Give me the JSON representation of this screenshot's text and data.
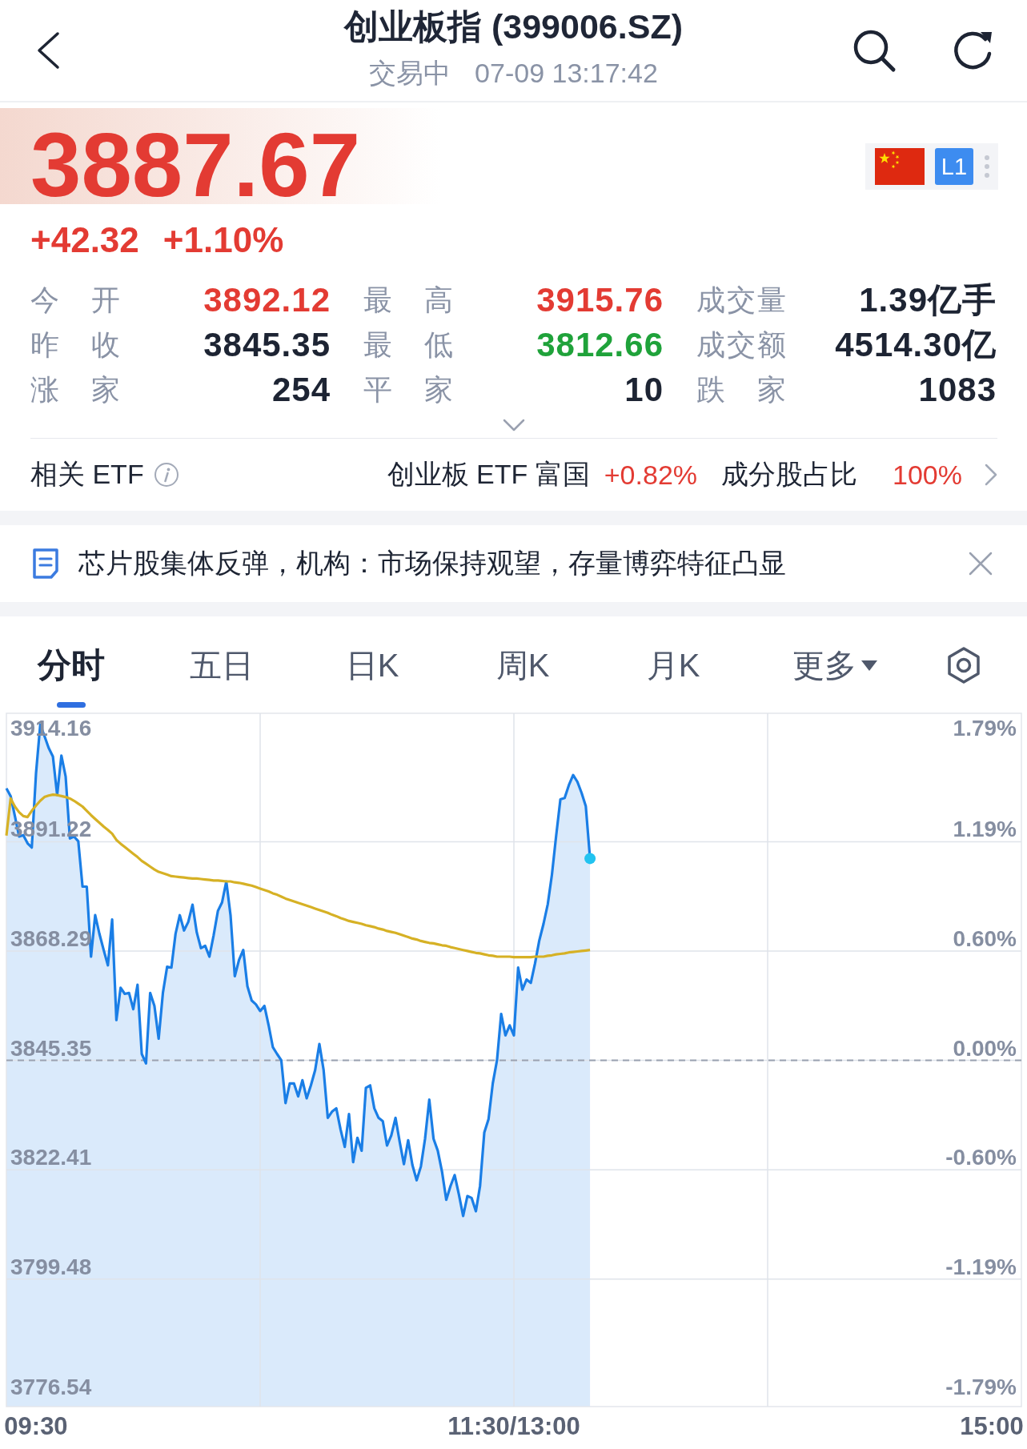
{
  "header": {
    "title": "创业板指 (399006.SZ)",
    "status": "交易中",
    "time": "07-09 13:17:42"
  },
  "quote": {
    "price": "3887.67",
    "change": "+42.32",
    "change_percent": "+1.10%",
    "rising": true,
    "level_badge": "L1"
  },
  "stats": {
    "expanded": false,
    "rows": [
      [
        {
          "label": "今 开",
          "value": "3892.12",
          "color": "#e33b33"
        },
        {
          "label": "最 高",
          "value": "3915.76",
          "color": "#e33b33"
        },
        {
          "label": "成交量",
          "value": "1.39亿手",
          "color": "#1d2433"
        }
      ],
      [
        {
          "label": "昨 收",
          "value": "3845.35",
          "color": "#1d2433"
        },
        {
          "label": "最 低",
          "value": "3812.66",
          "color": "#1fa23a"
        },
        {
          "label": "成交额",
          "value": "4514.30亿",
          "color": "#1d2433"
        }
      ],
      [
        {
          "label": "涨 家",
          "value": "254",
          "color": "#1d2433"
        },
        {
          "label": "平 家",
          "value": "10",
          "color": "#1d2433"
        },
        {
          "label": "跌 家",
          "value": "1083",
          "color": "#1d2433"
        }
      ]
    ]
  },
  "etf": {
    "label": "相关 ETF",
    "fund": "创业板 ETF 富国",
    "change": "+0.82%",
    "rising": true,
    "ratio_label": "成分股占比",
    "ratio": "100%"
  },
  "news": {
    "headline": "芯片股集体反弹，机构：市场保持观望，存量博弈特征凸显"
  },
  "chart_tabs": [
    {
      "label": "分时",
      "selected": true,
      "kind": "tab"
    },
    {
      "label": "五日",
      "selected": false,
      "kind": "tab"
    },
    {
      "label": "日K",
      "selected": false,
      "kind": "tab"
    },
    {
      "label": "周K",
      "selected": false,
      "kind": "tab"
    },
    {
      "label": "月K",
      "selected": false,
      "kind": "tab"
    },
    {
      "label": "更多",
      "selected": false,
      "kind": "menu"
    }
  ],
  "chart": {
    "percent_labels": [
      "1.79%",
      "1.19%",
      "0.60%",
      "0.00%",
      "-0.60%",
      "-1.19%",
      "-1.79%"
    ],
    "chart_data": {
      "type": "line",
      "grid": true,
      "categories": [
        null,
        null,
        null,
        null,
        null,
        null,
        null,
        "09:30",
        null,
        null,
        null,
        null,
        null,
        null,
        null,
        null,
        null,
        null,
        null,
        null,
        null,
        null,
        null,
        null,
        null,
        null,
        null,
        null,
        null,
        null,
        null,
        null,
        null,
        null,
        null,
        null,
        null,
        null,
        null,
        null,
        null,
        null,
        null,
        null,
        null,
        null,
        null,
        null,
        null,
        null,
        null,
        null,
        null,
        null,
        null,
        null,
        null,
        null,
        null,
        null,
        null,
        null,
        null,
        null,
        null,
        null,
        null,
        null,
        null,
        null,
        null,
        null,
        null,
        null,
        null,
        null,
        null,
        null,
        null,
        null,
        null,
        null,
        null,
        null,
        null,
        null,
        null,
        null,
        null,
        null,
        null,
        null,
        null,
        null,
        null,
        null,
        null,
        null,
        null,
        null,
        null,
        null,
        null,
        null,
        null,
        null,
        null,
        null,
        null,
        null,
        null,
        null,
        null,
        null,
        null,
        null,
        null,
        null,
        null,
        null,
        "11:30/13:00",
        null,
        null,
        null,
        null,
        null,
        null,
        null,
        null,
        null,
        null,
        null,
        null,
        null,
        null,
        null,
        null,
        null,
        null,
        null,
        null,
        null,
        null,
        null,
        null,
        null,
        null,
        null,
        null,
        null,
        null,
        null,
        null,
        null,
        null,
        null,
        null,
        null,
        null,
        null,
        null,
        null,
        null,
        null,
        null,
        null,
        null,
        null,
        null,
        null,
        null,
        null,
        null,
        null,
        null,
        null,
        null,
        null,
        null,
        null,
        null,
        null,
        null,
        null,
        null,
        null,
        null,
        null,
        null,
        null,
        null,
        null,
        null,
        null,
        null,
        null,
        null,
        null,
        null,
        null,
        null,
        null,
        null,
        null,
        null,
        null,
        null,
        null,
        null,
        null,
        null,
        null,
        null,
        null,
        null,
        null,
        null,
        null,
        null,
        null,
        null,
        null,
        null,
        null,
        null,
        null,
        null,
        null,
        null,
        null,
        null,
        null,
        null,
        "15:00",
        null,
        null,
        null,
        null,
        null,
        null,
        null
      ],
      "series": [
        {
          "color": "#1a7ee6",
          "values": [
            3902.4,
            3900.8,
            3896.6,
            3892.3,
            3892.6,
            3890.9,
            3890.0,
            3905.6,
            3915.8,
            3913.4,
            3910.9,
            3909.1,
            3901.0,
            3909.3,
            3904.9,
            3891.9,
            3892.3,
            3891.3,
            3881.8,
            3881.8,
            3867.1,
            3875.8,
            3871.9,
            3868.5,
            3865.3,
            3874.9,
            3853.8,
            3860.6,
            3859.3,
            3859.5,
            3856.1,
            3861.2,
            3846.7,
            3844.7,
            3859.5,
            3856.8,
            3849.9,
            3859.5,
            3865.0,
            3864.8,
            3871.9,
            3875.8,
            3872.6,
            3874.4,
            3878.0,
            3872.2,
            3868.9,
            3869.4,
            3867.1,
            3871.6,
            3876.7,
            3878.5,
            3882.9,
            3875.8,
            3863.0,
            3866.4,
            3868.5,
            3860.9,
            3857.9,
            3857.1,
            3855.7,
            3856.8,
            3852.7,
            3848.1,
            3846.7,
            3845.4,
            3836.4,
            3840.5,
            3840.5,
            3837.8,
            3841.2,
            3837.4,
            3840.1,
            3843.3,
            3848.8,
            3843.3,
            3833.3,
            3834.6,
            3835.3,
            3830.9,
            3827.2,
            3834.1,
            3824.0,
            3829.1,
            3826.4,
            3839.6,
            3840.1,
            3835.3,
            3833.3,
            3832.6,
            3827.5,
            3829.6,
            3833.3,
            3828.2,
            3823.6,
            3828.6,
            3823.4,
            3820.2,
            3823.1,
            3828.9,
            3837.1,
            3828.9,
            3826.4,
            3822.0,
            3816.1,
            3819.0,
            3821.3,
            3817.2,
            3812.7,
            3816.9,
            3816.5,
            3813.7,
            3819.0,
            3830.2,
            3833.0,
            3840.5,
            3845.4,
            3855.1,
            3850.6,
            3852.7,
            3850.6,
            3864.8,
            3860.2,
            3862.3,
            3861.6,
            3865.7,
            3870.5,
            3874.0,
            3878.1,
            3884.3,
            3892.5,
            3900.1,
            3900.4,
            3903.1,
            3905.2,
            3903.8,
            3901.5,
            3898.7,
            3887.7,
            null,
            null,
            null,
            null,
            null,
            null,
            null,
            null,
            null,
            null,
            null,
            null,
            null,
            null,
            null,
            null,
            null,
            null,
            null,
            null,
            null,
            null,
            null,
            null,
            null,
            null,
            null,
            null,
            null,
            null,
            null,
            null,
            null,
            null,
            null,
            null,
            null,
            null,
            null,
            null,
            null,
            null,
            null,
            null,
            null,
            null,
            null,
            null,
            null,
            null,
            null,
            null,
            null,
            null,
            null,
            null,
            null,
            null,
            null,
            null,
            null,
            null,
            null,
            null,
            null,
            null,
            null,
            null,
            null,
            null,
            null,
            null,
            null,
            null,
            null,
            null,
            null,
            null,
            null,
            null,
            null,
            null,
            null,
            null,
            null,
            null,
            null,
            null,
            null,
            null,
            null,
            null,
            null,
            null,
            null,
            null,
            null,
            null,
            null,
            null,
            null,
            null
          ]
        },
        {
          "color": "#d6b125",
          "values": [
            3892.5,
            3900.3,
            3898.6,
            3897.4,
            3896.6,
            3896.4,
            3897.7,
            3898.8,
            3899.8,
            3900.6,
            3900.9,
            3901.1,
            3901.0,
            3900.8,
            3900.6,
            3900.3,
            3899.8,
            3899.2,
            3898.6,
            3897.7,
            3896.8,
            3896.0,
            3895.2,
            3894.4,
            3893.7,
            3892.9,
            3891.6,
            3890.8,
            3890.1,
            3889.4,
            3888.7,
            3888.0,
            3887.2,
            3886.6,
            3886.0,
            3885.4,
            3884.9,
            3884.6,
            3884.3,
            3884.0,
            3883.9,
            3883.8,
            3883.7,
            3883.6,
            3883.5,
            3883.5,
            3883.4,
            3883.3,
            3883.2,
            3883.1,
            3883.1,
            3883.0,
            3882.9,
            3882.9,
            3882.7,
            3882.6,
            3882.4,
            3882.2,
            3882.0,
            3881.7,
            3881.4,
            3881.1,
            3880.8,
            3880.4,
            3880.1,
            3879.7,
            3879.3,
            3879.0,
            3878.7,
            3878.4,
            3878.1,
            3877.8,
            3877.5,
            3877.2,
            3876.9,
            3876.6,
            3876.3,
            3875.9,
            3875.6,
            3875.2,
            3874.9,
            3874.6,
            3874.4,
            3874.2,
            3874.0,
            3873.7,
            3873.5,
            3873.3,
            3873.0,
            3872.8,
            3872.5,
            3872.3,
            3872.1,
            3871.8,
            3871.5,
            3871.2,
            3870.9,
            3870.7,
            3870.4,
            3870.2,
            3870.0,
            3869.9,
            3869.7,
            3869.5,
            3869.4,
            3869.1,
            3868.9,
            3868.7,
            3868.5,
            3868.3,
            3868.1,
            3867.9,
            3867.8,
            3867.6,
            3867.4,
            3867.3,
            3867.1,
            3867.1,
            3867.1,
            3867.1,
            3867.0,
            3867.0,
            3867.0,
            3867.0,
            3867.0,
            3867.1,
            3867.1,
            3867.1,
            3867.3,
            3867.4,
            3867.6,
            3867.7,
            3867.8,
            3868.0,
            3868.1,
            3868.2,
            3868.3,
            3868.4,
            3868.5,
            null,
            null,
            null,
            null,
            null,
            null,
            null,
            null,
            null,
            null,
            null,
            null,
            null,
            null,
            null,
            null,
            null,
            null,
            null,
            null,
            null,
            null,
            null,
            null,
            null,
            null,
            null,
            null,
            null,
            null,
            null,
            null,
            null,
            null,
            null,
            null,
            null,
            null,
            null,
            null,
            null,
            null,
            null,
            null,
            null,
            null,
            null,
            null,
            null,
            null,
            null,
            null,
            null,
            null,
            null,
            null,
            null,
            null,
            null,
            null,
            null,
            null,
            null,
            null,
            null,
            null,
            null,
            null,
            null,
            null,
            null,
            null,
            null,
            null,
            null,
            null,
            null,
            null,
            null,
            null,
            null,
            null,
            null,
            null,
            null,
            null,
            null,
            null,
            null,
            null,
            null,
            null,
            null,
            null,
            null,
            null,
            null,
            null,
            null,
            null,
            null,
            null
          ]
        }
      ],
      "ylim": [
        3772.73,
        3918.16
      ],
      "yticks": [
        3914.16,
        3891.22,
        3868.29,
        3845.35,
        3822.41,
        3799.48,
        3776.54
      ],
      "ref_lines": [
        {
          "axis": "y",
          "value": 3845.35
        }
      ]
    }
  }
}
